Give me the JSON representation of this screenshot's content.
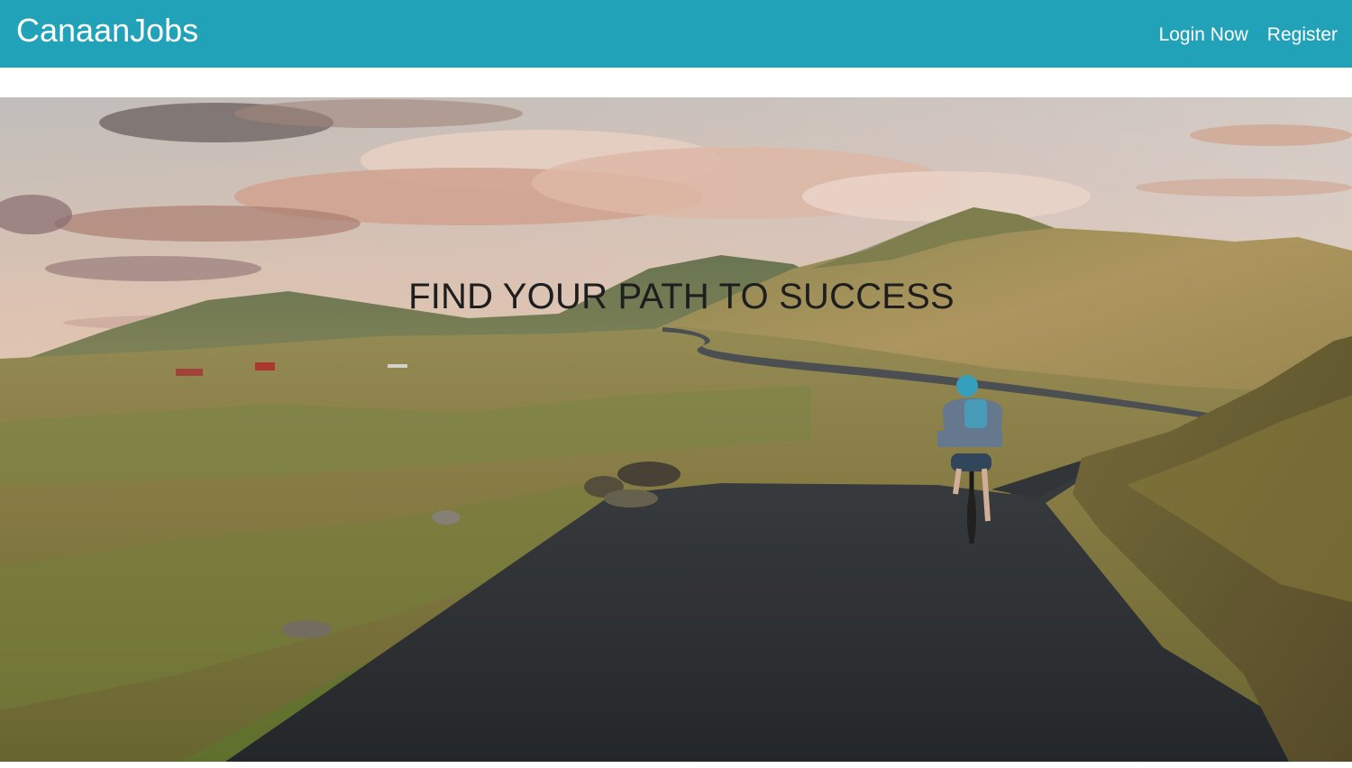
{
  "navbar": {
    "brand": "CanaanJobs",
    "background_color": "#22a2b8",
    "links": [
      {
        "label": "Login Now"
      },
      {
        "label": "Register"
      }
    ]
  },
  "hero": {
    "title": "FIND YOUR PATH TO SUCCESS",
    "image": "cyclist-on-mountain-road-photo"
  }
}
